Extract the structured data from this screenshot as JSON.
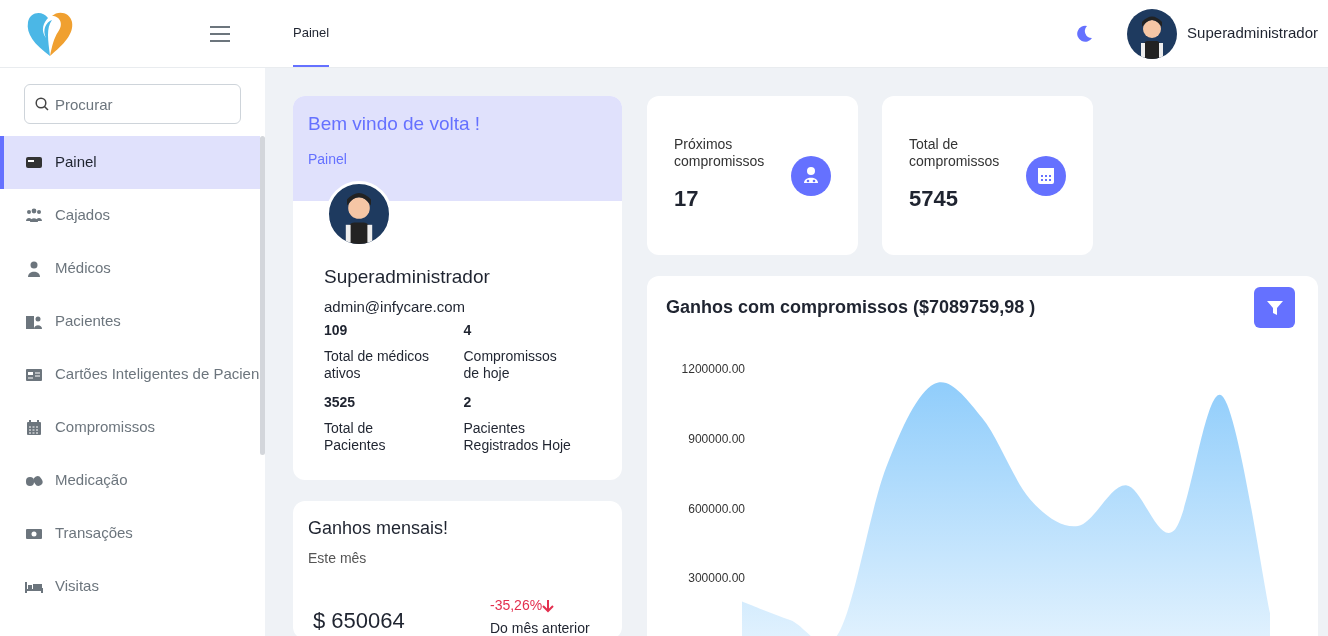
{
  "header": {
    "nav_tabs": [
      {
        "label": "Painel",
        "selected": true
      }
    ],
    "user": {
      "name": "Superadministrador"
    }
  },
  "sidebar": {
    "search": {
      "placeholder": "Procurar"
    },
    "items": [
      {
        "label": "Painel",
        "selected": true
      },
      {
        "label": "Cajados",
        "selected": false
      },
      {
        "label": "Médicos",
        "selected": false
      },
      {
        "label": "Pacientes",
        "selected": false
      },
      {
        "label": "Cartões Inteligentes de Pacien",
        "selected": false
      },
      {
        "label": "Compromissos",
        "selected": false
      },
      {
        "label": "Medicação",
        "selected": false
      },
      {
        "label": "Transações",
        "selected": false
      },
      {
        "label": "Visitas",
        "selected": false
      }
    ]
  },
  "welcome_card": {
    "title": "Bem vindo de volta !",
    "subtitle": "Painel",
    "name": "Superadministrador",
    "email": "admin@infycare.com",
    "stats": [
      {
        "value": "109",
        "label": "Total de médicos ativos"
      },
      {
        "value": "4",
        "label": "Compromissos de hoje"
      },
      {
        "value": "3525",
        "label": "Total de Pacientes"
      },
      {
        "value": "2",
        "label": "Pacientes Registrados Hoje"
      }
    ]
  },
  "monthly_earnings": {
    "title": "Ganhos mensais!",
    "subtitle": "Este mês",
    "amount": "$ 650064",
    "change": "-35,26%",
    "comparison": "Do mês anterior"
  },
  "stat_cards": [
    {
      "label": "Próximos compromissos",
      "value": "17"
    },
    {
      "label": "Total de compromissos",
      "value": "5745"
    }
  ],
  "earnings_chart": {
    "title": "Ganhos com compromissos ($7089759,98 )",
    "y_axis_labels": [
      "1200000.00",
      "900000.00",
      "600000.00",
      "300000.00"
    ]
  }
}
